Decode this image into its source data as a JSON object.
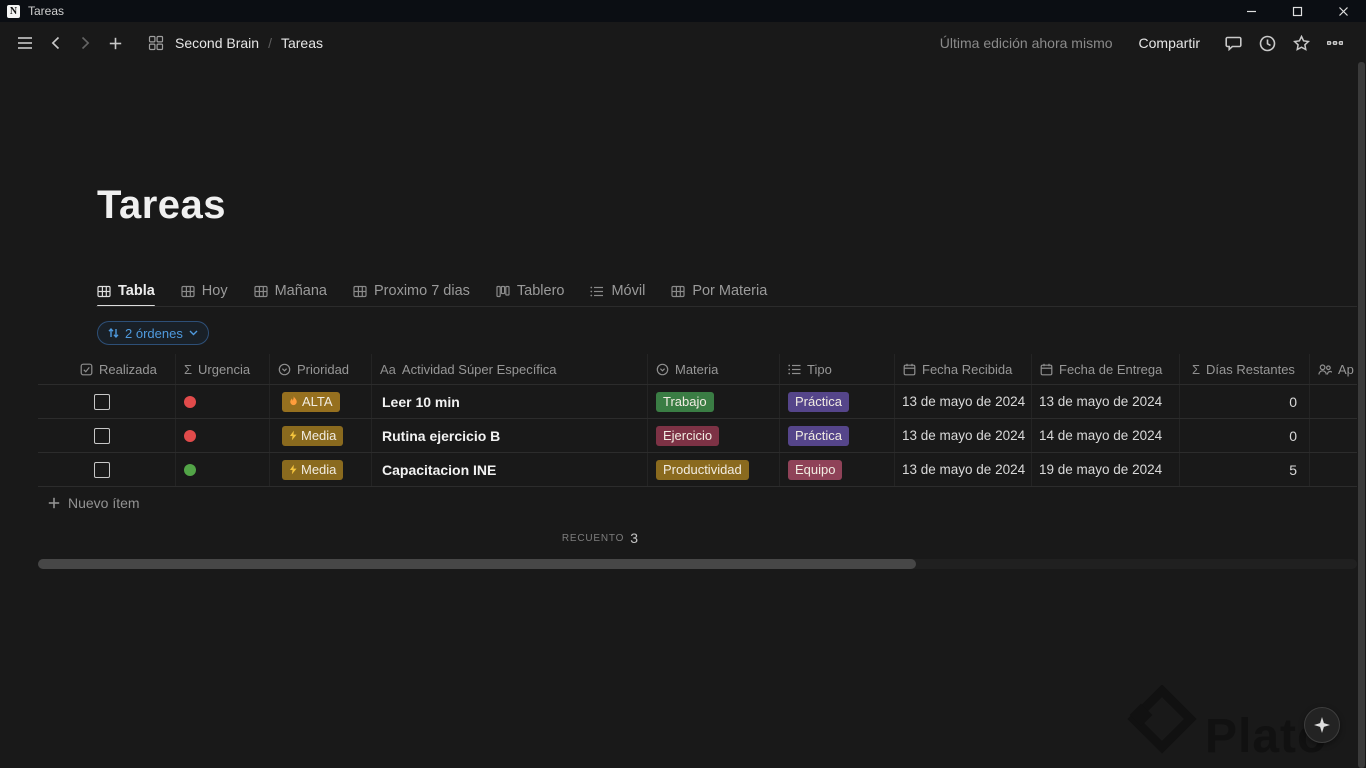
{
  "window": {
    "title": "Tareas",
    "app_icon_letter": "N"
  },
  "toolbar": {
    "breadcrumb": {
      "parent": "Second Brain",
      "separator": "/",
      "current": "Tareas"
    },
    "last_edited": "Última edición ahora mismo",
    "share_label": "Compartir"
  },
  "page": {
    "title": "Tareas"
  },
  "views": {
    "tabs": [
      {
        "label": "Tabla",
        "icon": "table",
        "active": true
      },
      {
        "label": "Hoy",
        "icon": "table",
        "active": false
      },
      {
        "label": "Mañana",
        "icon": "table",
        "active": false
      },
      {
        "label": "Proximo 7 dias",
        "icon": "table",
        "active": false
      },
      {
        "label": "Tablero",
        "icon": "board",
        "active": false
      },
      {
        "label": "Móvil",
        "icon": "list",
        "active": false
      },
      {
        "label": "Por Materia",
        "icon": "table",
        "active": false
      }
    ]
  },
  "sort": {
    "label": "2 órdenes"
  },
  "table": {
    "columns": [
      {
        "icon": "checkbox",
        "label": "Realizada"
      },
      {
        "icon": "sigma",
        "label": "Urgencia"
      },
      {
        "icon": "select",
        "label": "Prioridad"
      },
      {
        "icon": "text",
        "label": "Actividad Súper Específica"
      },
      {
        "icon": "select",
        "label": "Materia"
      },
      {
        "icon": "multi-select",
        "label": "Tipo"
      },
      {
        "icon": "calendar",
        "label": "Fecha Recibida"
      },
      {
        "icon": "calendar",
        "label": "Fecha de Entrega"
      },
      {
        "icon": "sigma",
        "label": "Días Restantes"
      },
      {
        "icon": "people",
        "label": "Ap"
      }
    ],
    "rows": [
      {
        "checked": false,
        "urgencia_color": "#e14b4b",
        "prioridad": {
          "label": "ALTA",
          "icon": "flame",
          "bg": "#96701f"
        },
        "actividad": "Leer 10 min",
        "materia": {
          "label": "Trabajo",
          "bg": "#3a7d44"
        },
        "tipo": {
          "label": "Práctica",
          "bg": "#55458a"
        },
        "fecha_recibida": "13 de mayo de 2024",
        "fecha_entrega": "13 de mayo de 2024",
        "dias_restantes": "0"
      },
      {
        "checked": false,
        "urgencia_color": "#e14b4b",
        "prioridad": {
          "label": "Media",
          "icon": "flash",
          "bg": "#8a6a1e"
        },
        "actividad": "Rutina ejercicio B",
        "materia": {
          "label": "Ejercicio",
          "bg": "#7d3245"
        },
        "tipo": {
          "label": "Práctica",
          "bg": "#55458a"
        },
        "fecha_recibida": "13 de mayo de 2024",
        "fecha_entrega": "14 de mayo de 2024",
        "dias_restantes": "0"
      },
      {
        "checked": false,
        "urgencia_color": "#52a447",
        "prioridad": {
          "label": "Media",
          "icon": "flash",
          "bg": "#8a6a1e"
        },
        "actividad": "Capacitacion INE",
        "materia": {
          "label": "Productividad",
          "bg": "#8a6a1e"
        },
        "tipo": {
          "label": "Equipo",
          "bg": "#8f4258"
        },
        "fecha_recibida": "13 de mayo de 2024",
        "fecha_entrega": "19 de mayo de 2024",
        "dias_restantes": "5"
      }
    ],
    "new_item_label": "Nuevo ítem",
    "footer": {
      "calc_label": "recuento",
      "calc_value": "3"
    }
  },
  "watermark": {
    "text": "Plato"
  }
}
